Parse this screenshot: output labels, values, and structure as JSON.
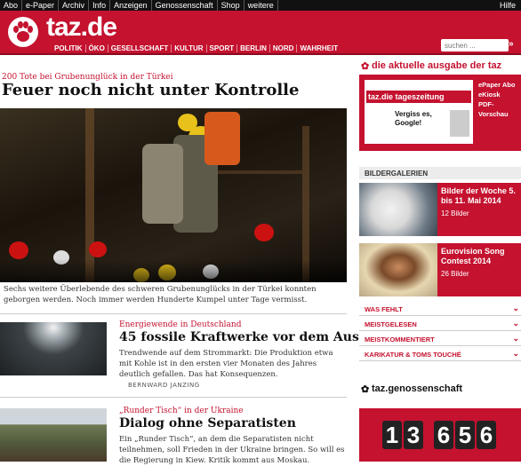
{
  "topnav": {
    "items": [
      "Abo",
      "e-Paper",
      "Archiv",
      "Info",
      "Anzeigen",
      "Genossenschaft",
      "Shop",
      "weitere"
    ],
    "help": "Hilfe"
  },
  "brand": {
    "logo_text": "taz.de"
  },
  "nav": {
    "items": [
      "POLITIK",
      "ÖKO",
      "GESELLSCHAFT",
      "KULTUR",
      "SPORT",
      "BERLIN",
      "NORD",
      "WAHRHEIT"
    ]
  },
  "search": {
    "placeholder": "suchen ..."
  },
  "lead": {
    "kicker": "200 Tote bei Grubenunglück in der Türkei",
    "title": "Feuer noch nicht unter Kontrolle",
    "caption": "Sechs weitere Überlebende des schweren Grubenunglücks in der Türkei konnten geborgen werden. Noch immer werden Hunderte Kumpel unter Tage vermisst."
  },
  "articles": [
    {
      "kicker": "Energiewende in Deutschland",
      "title": "45 fossile Kraftwerke vor dem Aus",
      "text": "Trendwende auf dem Strommarkt: Die Produktion etwa mit Kohle ist in den ersten vier Monaten des Jahres deutlich gefallen. Das hat Konsequenzen.",
      "author": "BERNWARD JANZING"
    },
    {
      "kicker": "„Runder Tisch“ in der Ukraine",
      "title": "Dialog ohne Separatisten",
      "text": "Ein „Runder Tisch“, an dem die Separatisten nicht teilnehmen, soll Frieden in der Ukraine bringen. So will es die Regierung in Kiew. Kritik kommt aus Moskau."
    }
  ],
  "sidebar": {
    "edition_heading": "die aktuelle ausgabe der taz",
    "edition_links": [
      "ePaper Abo",
      "eKiosk",
      "PDF-Vorschau"
    ],
    "paper_title": "taz.die tageszeitung",
    "paper_headline": "Vergiss es, Google!",
    "galleries_heading": "BILDERGALERIEN",
    "galleries": [
      {
        "title": "Bilder der Woche 5. bis 11. Mai 2014",
        "count": "12 Bilder"
      },
      {
        "title": "Eurovision Song Contest 2014",
        "count": "26 Bilder"
      }
    ],
    "sections": [
      "WAS FEHLT",
      "MEISTGELESEN",
      "MEISTKOMMENTIERT",
      "KARIKATUR & TOMS TOUCHÉ"
    ],
    "coop_heading": "taz.genossenschaft",
    "coop_count": [
      "1",
      "3",
      "6",
      "5",
      "6"
    ]
  },
  "colors": {
    "brand": "#c4122f",
    "dark": "#111111"
  }
}
